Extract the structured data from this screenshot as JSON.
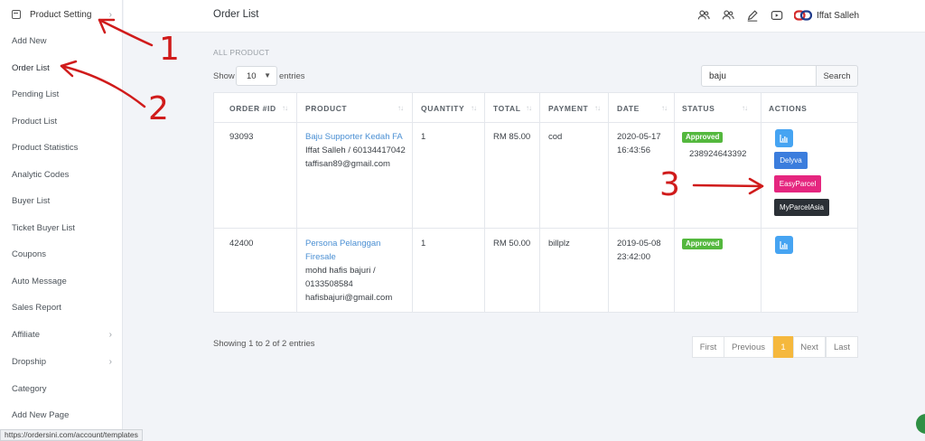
{
  "sidebar": {
    "header": {
      "label": "Product Setting",
      "icon": "box-icon"
    },
    "items": [
      {
        "label": "Add New"
      },
      {
        "label": "Order List"
      },
      {
        "label": "Pending List"
      },
      {
        "label": "Product List"
      },
      {
        "label": "Product Statistics"
      },
      {
        "label": "Analytic Codes"
      },
      {
        "label": "Buyer List"
      },
      {
        "label": "Ticket Buyer List"
      },
      {
        "label": "Coupons"
      },
      {
        "label": "Auto Message"
      },
      {
        "label": "Sales Report"
      },
      {
        "label": "Affiliate"
      },
      {
        "label": "Dropship"
      },
      {
        "label": "Category"
      },
      {
        "label": "Add New Page"
      }
    ]
  },
  "header": {
    "title": "Order List",
    "user_name": "Iffat Salleh",
    "icons": [
      "users-icon",
      "users-icon",
      "pen-icon",
      "youtube-icon",
      "brand-logo-icon"
    ]
  },
  "breadcrumb": "ALL PRODUCT",
  "table_controls": {
    "show_label": "Show",
    "entries_value": "10",
    "entries_label": "entries",
    "search_value": "baju",
    "search_button": "Search"
  },
  "table": {
    "columns": [
      "ORDER #ID",
      "PRODUCT",
      "QUANTITY",
      "TOTAL",
      "PAYMENT",
      "DATE",
      "STATUS",
      "ACTIONS"
    ],
    "rows": [
      {
        "order_id": "93093",
        "product_name": "Baju Supporter Kedah FA",
        "buyer_line": "Iffat Salleh / 60134417042",
        "email": "taffisan89@gmail.com",
        "quantity": "1",
        "total": "RM 85.00",
        "payment": "cod",
        "date": "2020-05-17",
        "time": "16:43:56",
        "status": "Approved",
        "tracking": "238924643392",
        "actions": [
          "Delyva",
          "EasyParcel",
          "MyParcelAsia"
        ]
      },
      {
        "order_id": "42400",
        "product_name_1": "Persona Pelanggan",
        "product_name_2": "Firesale",
        "buyer_line_1": "mohd hafis bajuri /",
        "buyer_line_2": "0133508584",
        "email": "hafisbajuri@gmail.com",
        "quantity": "1",
        "total": "RM 50.00",
        "payment": "billplz",
        "date": "2019-05-08",
        "time": "23:42:00",
        "status": "Approved"
      }
    ]
  },
  "pagination": {
    "showing": "Showing 1 to 2 of 2 entries",
    "first": "First",
    "previous": "Previous",
    "current": "1",
    "next": "Next",
    "last": "Last"
  },
  "annotations": [
    "1",
    "2",
    "3"
  ],
  "status_url": "https://ordersini.com/account/templates",
  "colors": {
    "link": "#4a8fd3",
    "approved": "#54b83e",
    "delyva": "#3b7ddd",
    "easyparcel": "#e5267f",
    "myparcelasia": "#2b3036",
    "pager_active": "#f5b83d",
    "annotation": "#d01b1b"
  }
}
